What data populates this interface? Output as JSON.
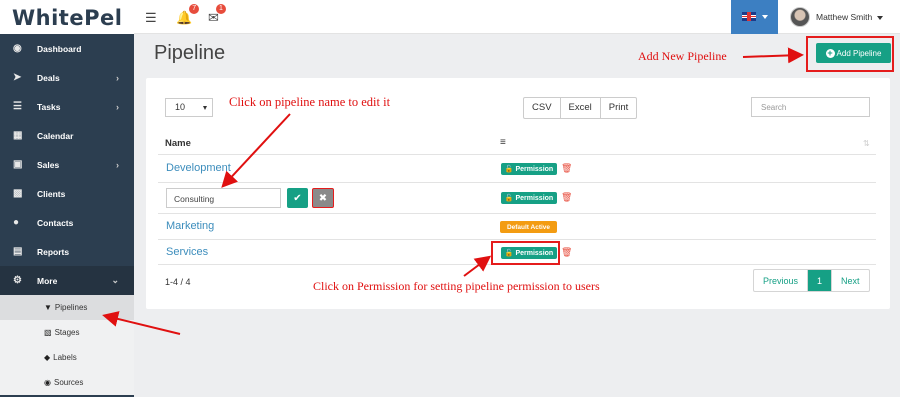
{
  "app": {
    "brand": "WhitePel"
  },
  "topbar": {
    "menu_icon": "menu-icon",
    "notifications_count": "7",
    "messages_count": "1",
    "user_name": "Matthew Smith"
  },
  "sidebar": {
    "items": [
      {
        "label": "Dashboard",
        "icon": "dashboard-icon",
        "chevron": ""
      },
      {
        "label": "Deals",
        "icon": "rocket-icon",
        "chevron": "›"
      },
      {
        "label": "Tasks",
        "icon": "tasks-icon",
        "chevron": "›"
      },
      {
        "label": "Calendar",
        "icon": "calendar-icon",
        "chevron": ""
      },
      {
        "label": "Sales",
        "icon": "cart-icon",
        "chevron": "›"
      },
      {
        "label": "Clients",
        "icon": "building-icon",
        "chevron": ""
      },
      {
        "label": "Contacts",
        "icon": "users-icon",
        "chevron": ""
      },
      {
        "label": "Reports",
        "icon": "chart-icon",
        "chevron": ""
      },
      {
        "label": "More",
        "icon": "gear-icon",
        "chevron": "⌄"
      }
    ],
    "sub_items": [
      {
        "label": "Pipelines",
        "icon": "filter-icon"
      },
      {
        "label": "Stages",
        "icon": "sitemap-icon"
      },
      {
        "label": "Labels",
        "icon": "tag-icon"
      },
      {
        "label": "Sources",
        "icon": "eye-icon"
      }
    ]
  },
  "main": {
    "title": "Pipeline",
    "add_button": "Add Pipeline",
    "per_page": "10",
    "export_buttons": [
      "CSV",
      "Excel",
      "Print"
    ],
    "search_placeholder": "Search",
    "table": {
      "col_name": "Name",
      "rows": [
        {
          "name": "Development",
          "action": "Permission"
        },
        {
          "name": "Consulting",
          "action": "Permission",
          "editing": true
        },
        {
          "name": "Marketing",
          "action": "Default Active"
        },
        {
          "name": "Services",
          "action": "Permission"
        }
      ]
    },
    "count_text": "1-4 / 4",
    "pagination": {
      "prev": "Previous",
      "current": "1",
      "next": "Next"
    }
  },
  "annotations": {
    "add_new": "Add New Pipeline",
    "click_name": "Click on pipeline name to edit it",
    "click_permission": "Click on Permission for setting pipeline permission to users"
  },
  "colors": {
    "accent": "#16a085",
    "sidebar": "#2c3e50",
    "annotation": "#e01010",
    "warning": "#f39c12",
    "link": "#3c8dbc"
  }
}
